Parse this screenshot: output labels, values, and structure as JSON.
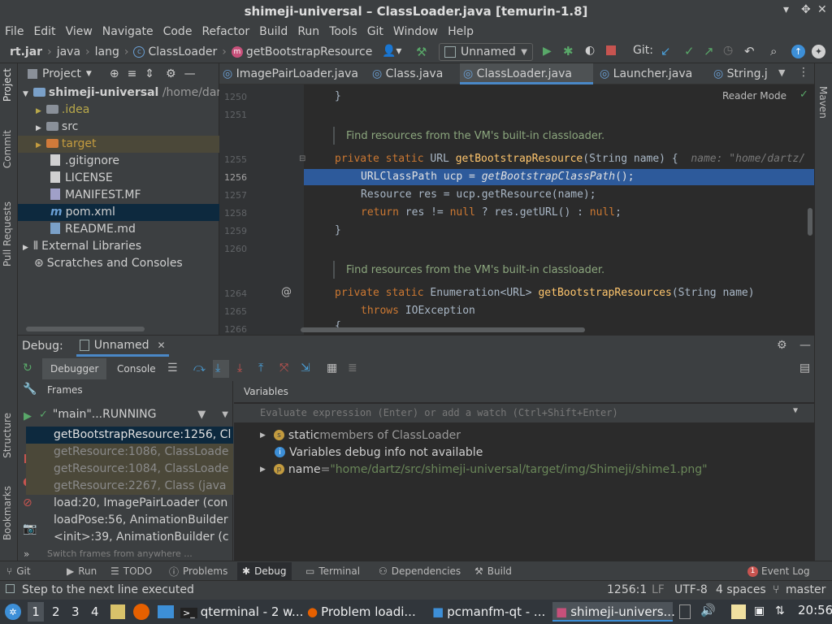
{
  "window": {
    "title": "shimeji-universal – ClassLoader.java [temurin-1.8]"
  },
  "menu": [
    "File",
    "Edit",
    "View",
    "Navigate",
    "Code",
    "Refactor",
    "Build",
    "Run",
    "Tools",
    "Git",
    "Window",
    "Help"
  ],
  "breadcrumbs": [
    "rt.jar",
    "java",
    "lang",
    "ClassLoader",
    "getBootstrapResource"
  ],
  "run_config": "Unnamed",
  "git_label": "Git:",
  "project": {
    "title": "Project",
    "root": "shimeji-universal",
    "root_path": "/home/dartz",
    "items": [
      ".idea",
      "src",
      "target",
      ".gitignore",
      "LICENSE",
      "MANIFEST.MF",
      "pom.xml",
      "README.md",
      "External Libraries",
      "Scratches and Consoles"
    ]
  },
  "editor": {
    "tabs": [
      "ImagePairLoader.java",
      "Class.java",
      "ClassLoader.java",
      "Launcher.java",
      "String.j"
    ],
    "reader_mode": "Reader Mode",
    "line_numbers": [
      "1250",
      "1251",
      "1255",
      "1256",
      "1257",
      "1258",
      "1259",
      "1260",
      "1264",
      "1265",
      "1266"
    ],
    "doc1": "Find resources from the VM's built-in classloader.",
    "doc2": "Find resources from the VM's built-in classloader.",
    "hint": "name: \"home/dartz/",
    "code": {
      "brace_close": "}",
      "l1255_mod": "private static",
      "l1255_type": "URL",
      "l1255_fn": "getBootstrapResource",
      "l1255_args": "(String name) {",
      "l1256_a": "URLClassPath ucp = ",
      "l1256_b": "getBootstrapClassPath",
      "l1256_c": "();",
      "l1257": "Resource res = ucp.getResource(name);",
      "l1258_kw": "return",
      "l1258_a": " res != ",
      "l1258_null1": "null",
      "l1258_b": " ? res.getURL() : ",
      "l1258_null2": "null",
      "l1258_c": ";",
      "l1259": "}",
      "l1264_mod": "private static",
      "l1264_type": "Enumeration<URL>",
      "l1264_fn": "getBootstrapResources",
      "l1264_args": "(String name)",
      "l1265_kw": "throws",
      "l1265_rest": " IOException",
      "l1266": "{"
    }
  },
  "debug": {
    "label": "Debug:",
    "session": "Unnamed",
    "tabs": [
      "Debugger",
      "Console"
    ],
    "frames_title": "Frames",
    "variables_title": "Variables",
    "thread": "\"main\"...RUNNING",
    "frames": [
      "getBootstrapResource:1256, Cl",
      "getResource:1086, ClassLoade",
      "getResource:1084, ClassLoade",
      "getResource:2267, Class (java",
      "load:20, ImagePairLoader (con",
      "loadPose:56, AnimationBuilder",
      "<init>:39, AnimationBuilder (c"
    ],
    "switch_frames": "Switch frames from anywhere ...",
    "eval_placeholder": "Evaluate expression (Enter) or add a watch (Ctrl+Shift+Enter)",
    "vars": {
      "static_label": "static",
      "static_rest": " members of ClassLoader",
      "info": "Variables debug info not available",
      "name_label": "name",
      "name_eq": " = ",
      "name_value": "\"home/dartz/src/shimeji-universal/target/img/Shimeji/shime1.png\""
    }
  },
  "toolwindows": [
    "Git",
    "Run",
    "TODO",
    "Problems",
    "Debug",
    "Terminal",
    "Dependencies",
    "Build"
  ],
  "event_log": "Event Log",
  "event_count": "1",
  "status": {
    "message": "Step to the next line executed",
    "position": "1256:1",
    "line_sep": "LF",
    "encoding": "UTF-8",
    "indent": "4 spaces",
    "branch": "master"
  },
  "side_tabs": {
    "left": [
      "Project",
      "Commit",
      "Pull Requests",
      "Structure",
      "Bookmarks"
    ],
    "right": [
      "Maven"
    ]
  },
  "taskbar": {
    "workspaces": [
      "1",
      "2",
      "3",
      "4"
    ],
    "tasks": [
      "qterminal - 2 w...",
      "Problem loadi...",
      "pcmanfm-qt - ...",
      "shimeji-univers..."
    ],
    "clock": "20:56"
  },
  "colors": {
    "accent": "#4a88c7",
    "selection": "#2d5a9b",
    "keyword": "#cc7832",
    "function": "#ffc66d",
    "comment": "#629755",
    "string": "#6a8759",
    "run_green": "#59a869",
    "stop_red": "#c75450"
  }
}
